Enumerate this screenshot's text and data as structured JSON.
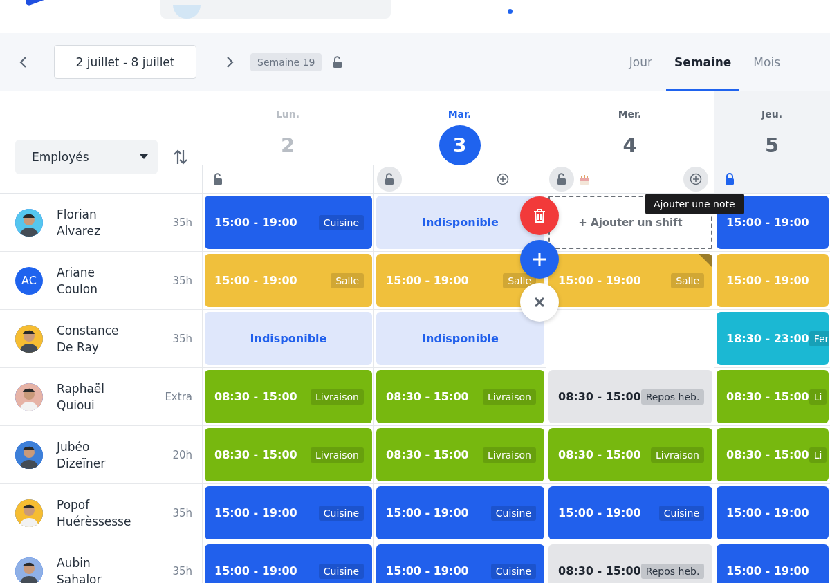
{
  "toolbar": {
    "date_range": "2 juillet - 8 juillet",
    "week_badge": "Semaine 19",
    "week_locked": false,
    "view_tabs": [
      {
        "label": "Jour",
        "selected": false
      },
      {
        "label": "Semaine",
        "selected": true
      },
      {
        "label": "Mois",
        "selected": false
      }
    ]
  },
  "filter": {
    "value": "Employés"
  },
  "days": [
    {
      "weekday": "Lun.",
      "date": "2",
      "past": true,
      "selected": false,
      "shaded": false,
      "locked": false,
      "lock_ring": false,
      "birthday": false,
      "add_button": false,
      "add_ring": false
    },
    {
      "weekday": "Mar.",
      "date": "3",
      "past": false,
      "selected": true,
      "shaded": false,
      "locked": false,
      "lock_ring": true,
      "birthday": false,
      "add_button": true,
      "add_ring": false
    },
    {
      "weekday": "Mer.",
      "date": "4",
      "past": false,
      "selected": false,
      "shaded": false,
      "locked": false,
      "lock_ring": true,
      "birthday": true,
      "add_button": true,
      "add_ring": true
    },
    {
      "weekday": "Jeu.",
      "date": "5",
      "past": false,
      "selected": false,
      "shaded": true,
      "locked": true,
      "lock_ring": false,
      "birthday": false,
      "add_button": false,
      "add_ring": false
    }
  ],
  "tooltip": "Ajouter une note",
  "employees": [
    {
      "first_name": "Florian",
      "last_name": "Alvarez",
      "hours": "35h",
      "cells": [
        {
          "kind": "shift",
          "time": "15:00 - 19:00",
          "tag": "Cuisine",
          "color": "#2160ec"
        },
        {
          "kind": "unavailable",
          "text": "Indisponible"
        },
        {
          "kind": "add",
          "text": "+ Ajouter un shift"
        },
        {
          "kind": "shift",
          "time": "15:00 - 19:00",
          "color": "#2160ec"
        }
      ]
    },
    {
      "first_name": "Ariane",
      "last_name": "Coulon",
      "hours": "35h",
      "avatar": {
        "kind": "initials",
        "initials": "AC"
      },
      "cells": [
        {
          "kind": "shift",
          "time": "15:00 - 19:00",
          "tag": "Salle",
          "color": "#f0c03c"
        },
        {
          "kind": "shift",
          "time": "15:00 - 19:00",
          "tag": "Salle",
          "color": "#f0c03c"
        },
        {
          "kind": "shift",
          "time": "15:00 - 19:00",
          "tag": "Salle",
          "color": "#f0c03c",
          "note": true
        },
        {
          "kind": "shift",
          "time": "15:00 - 19:00",
          "color": "#f0c03c"
        }
      ]
    },
    {
      "first_name": "Constance",
      "last_name": "De Ray",
      "hours": "35h",
      "cells": [
        {
          "kind": "unavailable",
          "text": "Indisponible"
        },
        {
          "kind": "unavailable",
          "text": "Indisponible"
        },
        {
          "kind": "empty"
        },
        {
          "kind": "shift",
          "time": "18:30 - 23:00",
          "tag": "Fer",
          "color": "#1bb8d3"
        }
      ]
    },
    {
      "first_name": "Raphaël",
      "last_name": "Quioui",
      "hours": "Extra",
      "cells": [
        {
          "kind": "shift",
          "time": "08:30 - 15:00",
          "tag": "Livraison",
          "color": "#77b80f"
        },
        {
          "kind": "shift",
          "time": "08:30 - 15:00",
          "tag": "Livraison",
          "color": "#77b80f"
        },
        {
          "kind": "rest",
          "time": "08:30 - 15:00",
          "tag": "Repos heb."
        },
        {
          "kind": "shift",
          "time": "08:30 - 15:00",
          "tag": "Li",
          "color": "#77b80f"
        }
      ]
    },
    {
      "first_name": "Jubéo",
      "last_name": "Dizeïner",
      "hours": "20h",
      "cells": [
        {
          "kind": "shift",
          "time": "08:30 - 15:00",
          "tag": "Livraison",
          "color": "#77b80f"
        },
        {
          "kind": "shift",
          "time": "08:30 - 15:00",
          "tag": "Livraison",
          "color": "#77b80f"
        },
        {
          "kind": "shift",
          "time": "08:30 - 15:00",
          "tag": "Livraison",
          "color": "#77b80f"
        },
        {
          "kind": "shift",
          "time": "08:30 - 15:00",
          "tag": "Li",
          "color": "#77b80f"
        }
      ]
    },
    {
      "first_name": "Popof",
      "last_name": "Huérèssesse",
      "hours": "35h",
      "cells": [
        {
          "kind": "shift",
          "time": "15:00 - 19:00",
          "tag": "Cuisine",
          "color": "#2160ec"
        },
        {
          "kind": "shift",
          "time": "15:00 - 19:00",
          "tag": "Cuisine",
          "color": "#2160ec"
        },
        {
          "kind": "shift",
          "time": "15:00 - 19:00",
          "tag": "Cuisine",
          "color": "#2160ec"
        },
        {
          "kind": "shift",
          "time": "15:00 - 19:00",
          "color": "#2160ec"
        }
      ]
    },
    {
      "first_name": "Aubin",
      "last_name": "Sahalor",
      "hours": "35h",
      "cells": [
        {
          "kind": "shift",
          "time": "15:00 - 19:00",
          "tag": "Cuisine",
          "color": "#2160ec"
        },
        {
          "kind": "shift",
          "time": "15:00 - 19:00",
          "tag": "Cuisine",
          "color": "#2160ec"
        },
        {
          "kind": "rest",
          "time": "08:30 - 15:00",
          "tag": "Repos heb."
        },
        {
          "kind": "shift",
          "time": "15:00 - 19:00",
          "color": "#2160ec"
        }
      ]
    }
  ]
}
